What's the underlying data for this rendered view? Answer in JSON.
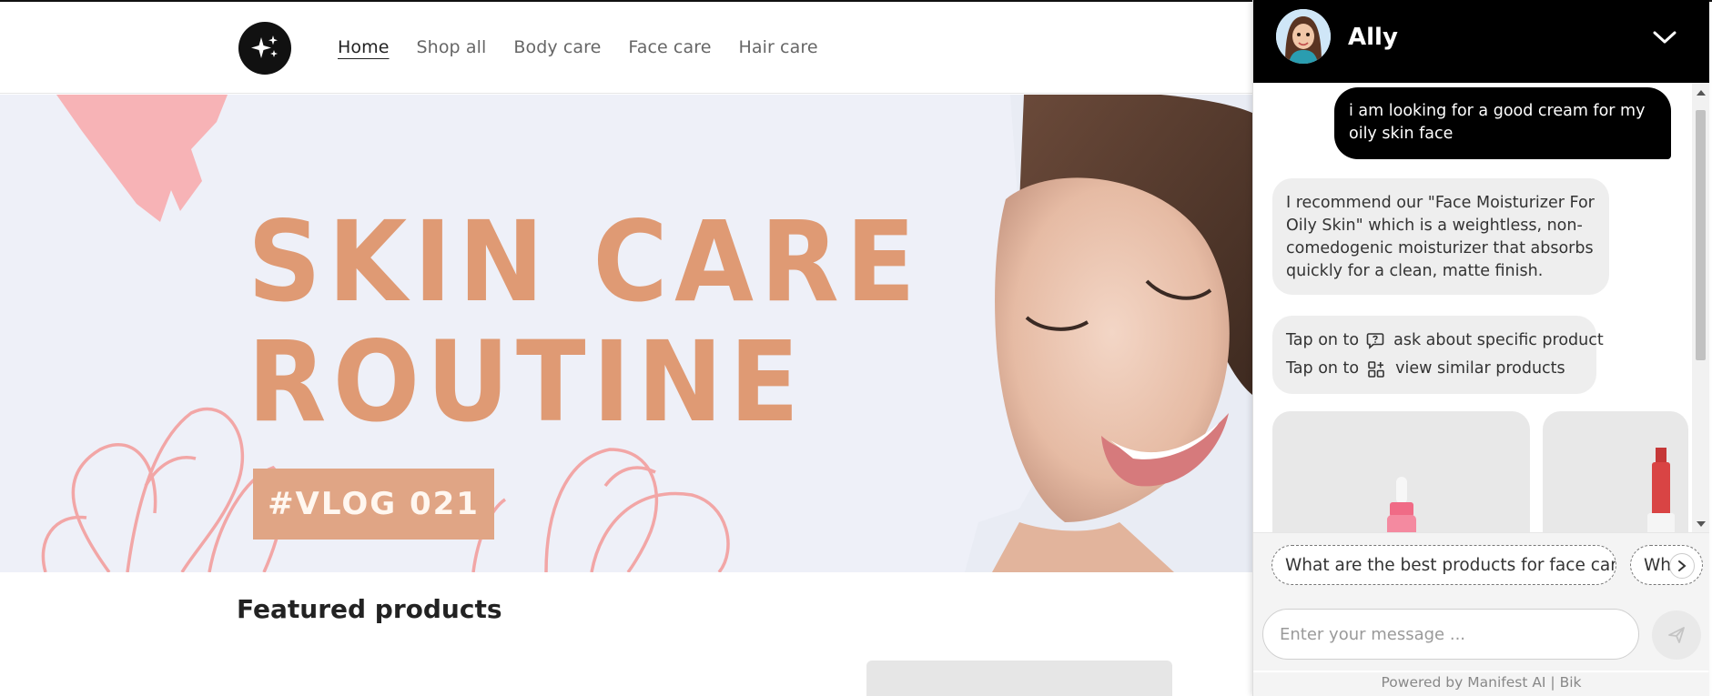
{
  "site": {
    "nav": [
      {
        "label": "Home",
        "active": true
      },
      {
        "label": "Shop all",
        "active": false
      },
      {
        "label": "Body care",
        "active": false
      },
      {
        "label": "Face care",
        "active": false
      },
      {
        "label": "Hair care",
        "active": false
      }
    ],
    "logo_icon": "sparkles-icon"
  },
  "hero": {
    "title_line1": "SKIN CARE",
    "title_line2": "ROUTINE",
    "tag": "#VLOG 021",
    "accent_color": "#df9a74"
  },
  "featured": {
    "heading": "Featured products"
  },
  "chat": {
    "bot_name": "Ally",
    "header_color": "#000000",
    "messages": {
      "user": "i am looking for a good cream for my oily skin face",
      "bot": "I recommend our \"Face Moisturizer For Oily Skin\" which is a weightless, non-comedogenic moisturizer that absorbs quickly for a clean, matte finish."
    },
    "tips": {
      "prefix": "Tap on to",
      "ask_label": "ask about specific product",
      "similar_label": "view similar products",
      "ask_icon": "chat-question-icon",
      "similar_icon": "grid-plus-icon"
    },
    "suggestions": [
      "What are the best products for face care?",
      "Wh"
    ],
    "composer": {
      "placeholder": "Enter your message ..."
    },
    "footer": "Powered by Manifest AI | Bik"
  }
}
